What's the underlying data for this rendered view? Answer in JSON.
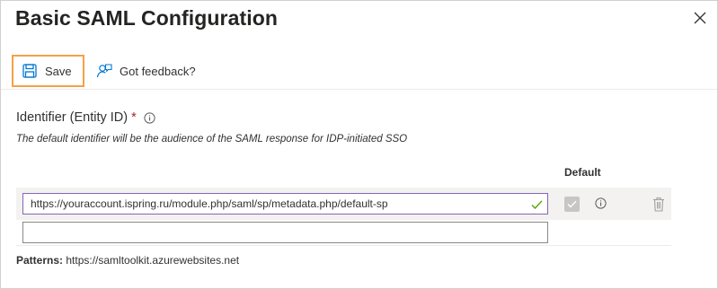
{
  "panel": {
    "title": "Basic SAML Configuration"
  },
  "toolbar": {
    "save_label": "Save",
    "feedback_label": "Got feedback?"
  },
  "identifier": {
    "label": "Identifier (Entity ID)",
    "required_mark": "*",
    "description": "The default identifier will be the audience of the SAML response for IDP-initiated SSO",
    "default_column_header": "Default",
    "rows": [
      {
        "value": "https://youraccount.ispring.ru/module.php/saml/sp/metadata.php/default-sp",
        "is_default": true
      },
      {
        "value": ""
      }
    ]
  },
  "patterns": {
    "label": "Patterns:",
    "value": "https://samltoolkit.azurewebsites.net"
  },
  "colors": {
    "focus_outline": "#f5a04a",
    "input_border_active": "#8764b8",
    "valid_check": "#57a300",
    "required": "#a4262c",
    "icon_blue": "#0078d4"
  },
  "icons": {
    "close": "close-icon",
    "save": "save-icon",
    "feedback": "feedback-icon",
    "info": "info-icon",
    "valid": "checkmark-icon",
    "delete": "trash-icon"
  }
}
